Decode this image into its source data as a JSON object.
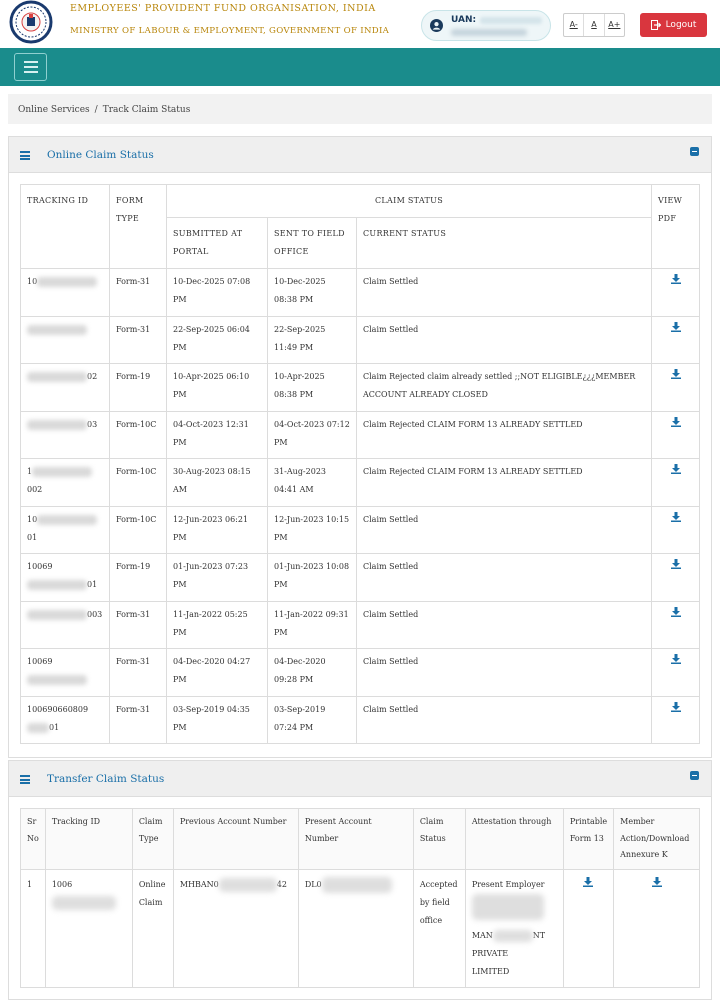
{
  "header": {
    "org_title": "EMPLOYEES' PROVIDENT FUND ORGANISATION, INDIA",
    "ministry": "MINISTRY OF LABOUR & EMPLOYMENT, GOVERNMENT OF INDIA",
    "uan_label": "UAN:",
    "font_buttons": [
      "A-",
      "A",
      "A+"
    ],
    "logout_label": "Logout",
    "icons": {
      "logo": "epfo-logo-icon",
      "user": "user-circle-icon",
      "logout": "logout-icon"
    },
    "colors": {
      "title_gold": "#b8860b",
      "nav_teal": "#1a8c8c",
      "logout_red": "#d9363e",
      "link_blue": "#1a6fa8"
    }
  },
  "breadcrumb": {
    "items": [
      "Online Services",
      "Track Claim Status"
    ],
    "separator": "/"
  },
  "claim_panel": {
    "title": "Online Claim Status",
    "headers": {
      "tracking_id": "TRACKING ID",
      "form_type": "FORM TYPE",
      "claim_status": "CLAIM STATUS",
      "view_pdf": "VIEW PDF",
      "submitted": "SUBMITTED AT PORTAL",
      "sent_field": "SENT TO FIELD OFFICE",
      "current_status": "CURRENT STATUS"
    },
    "rows": [
      {
        "id_prefix": "10",
        "id_suffix": "",
        "form": "Form-31",
        "submitted": "10-Dec-2025 07:08 PM",
        "sent": "10-Dec-2025 08:38 PM",
        "status": "Claim Settled"
      },
      {
        "id_prefix": "",
        "id_suffix": "",
        "form": "Form-31",
        "submitted": "22-Sep-2025 06:04 PM",
        "sent": "22-Sep-2025 11:49 PM",
        "status": "Claim Settled"
      },
      {
        "id_prefix": "",
        "id_suffix": "02",
        "form": "Form-19",
        "submitted": "10-Apr-2025 06:10 PM",
        "sent": "10-Apr-2025 08:38 PM",
        "status": "Claim Rejected claim already settled ;;NOT ELIGIBLE¿¿¿MEMBER ACCOUNT ALREADY CLOSED"
      },
      {
        "id_prefix": "",
        "id_suffix": "03",
        "form": "Form-10C",
        "submitted": "04-Oct-2023 12:31 PM",
        "sent": "04-Oct-2023 07:12 PM",
        "status": "Claim Rejected CLAIM FORM 13 ALREADY SETTLED"
      },
      {
        "id_prefix": "1",
        "id_suffix": "002",
        "form": "Form-10C",
        "submitted": "30-Aug-2023 08:15 AM",
        "sent": "31-Aug-2023 04:41 AM",
        "status": "Claim Rejected CLAIM FORM 13 ALREADY SETTLED"
      },
      {
        "id_prefix": "10",
        "id_suffix": "01",
        "form": "Form-10C",
        "submitted": "12-Jun-2023 06:21 PM",
        "sent": "12-Jun-2023 10:15 PM",
        "status": "Claim Settled"
      },
      {
        "id_prefix": "10069",
        "id_suffix": "01",
        "form": "Form-19",
        "submitted": "01-Jun-2023 07:23 PM",
        "sent": "01-Jun-2023 10:08 PM",
        "status": "Claim Settled"
      },
      {
        "id_prefix": "",
        "id_suffix": "003",
        "form": "Form-31",
        "submitted": "11-Jan-2022 05:25 PM",
        "sent": "11-Jan-2022 09:31 PM",
        "status": "Claim Settled"
      },
      {
        "id_prefix": "10069",
        "id_suffix": "",
        "form": "Form-31",
        "submitted": "04-Dec-2020 04:27 PM",
        "sent": "04-Dec-2020 09:28 PM",
        "status": "Claim Settled"
      },
      {
        "id_prefix": "100690660809",
        "id_suffix": "01",
        "form": "Form-31",
        "submitted": "03-Sep-2019 04:35 PM",
        "sent": "03-Sep-2019 07:24 PM",
        "status": "Claim Settled"
      }
    ]
  },
  "transfer_panel": {
    "title": "Transfer Claim Status",
    "headers": {
      "sr_no": "Sr No",
      "tracking_id": "Tracking ID",
      "claim_type": "Claim Type",
      "previous_account": "Previous Account Number",
      "present_account": "Present Account Number",
      "claim_status": "Claim Status",
      "attestation": "Attestation through",
      "printable": "Printable Form 13",
      "member_action": "Member Action/Download Annexure K"
    },
    "rows": [
      {
        "sr": "1",
        "tracking_prefix": "1006",
        "claim_type": "Online Claim",
        "previous_prefix": "MHBAN0",
        "previous_suffix": "42",
        "present_prefix": "DL0",
        "claim_status": "Accepted by field office",
        "attestation_line1": "Present Employer",
        "attestation_mid": "MAN",
        "attestation_mid_suffix": "NT",
        "attestation_line3": "PRIVATE",
        "attestation_line4": "LIMITED"
      }
    ]
  }
}
